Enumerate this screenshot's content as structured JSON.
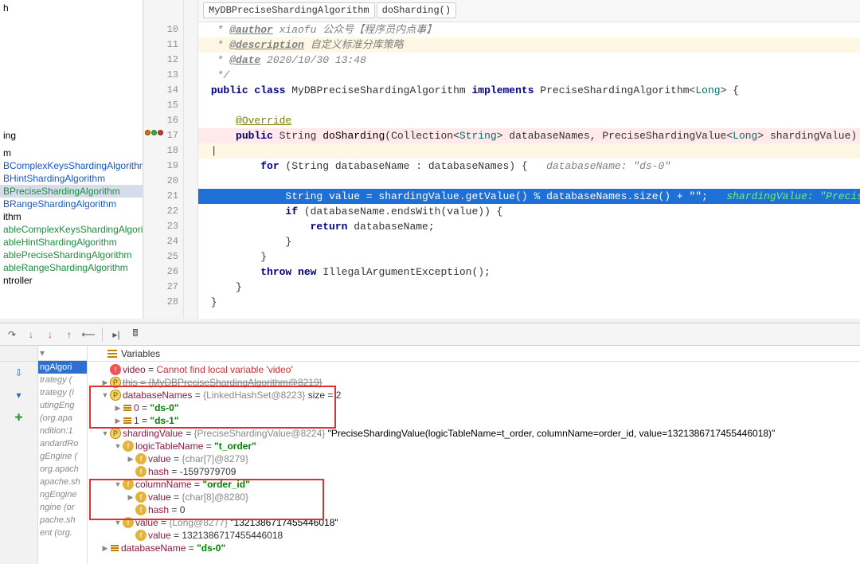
{
  "breadcrumb": {
    "class": "MyDBPreciseShardingAlgorithm",
    "method": "doSharding()"
  },
  "sidebar": {
    "topItems": [
      "h",
      "",
      "",
      "",
      "",
      "",
      "ing"
    ],
    "packages": [
      "m",
      "ithm"
    ],
    "classes": [
      {
        "label": "BComplexKeysShardingAlgorithm",
        "kind": "blue"
      },
      {
        "label": "BHintShardingAlgorithm",
        "kind": "blue"
      },
      {
        "label": "BPreciseShardingAlgorithm",
        "kind": "green",
        "selected": true
      },
      {
        "label": "BRangeShardingAlgorithm",
        "kind": "blue"
      },
      {
        "label": "ableComplexKeysShardingAlgorithm",
        "kind": "green"
      },
      {
        "label": "ableHintShardingAlgorithm",
        "kind": "green"
      },
      {
        "label": "ablePreciseShardingAlgorithm",
        "kind": "green"
      },
      {
        "label": "ableRangeShardingAlgorithm",
        "kind": "green"
      }
    ],
    "controllerLabel": "ntroller"
  },
  "code": {
    "startLine": 10,
    "lines": [
      {
        "n": 10,
        "html": "  <span class='jd'>* <span class='tag'>@author</span> xiaofu 公众号【程序员内点事】</span>"
      },
      {
        "n": 11,
        "html": "  <span class='jd'>* <span class='tag'>@description</span> 自定义标准分库策略</span>",
        "hly": true
      },
      {
        "n": 12,
        "html": "  <span class='jd'>* <span class='tag'>@date</span> 2020/10/30 13:48</span>"
      },
      {
        "n": 13,
        "html": "  <span class='jd'>*/</span>"
      },
      {
        "n": 14,
        "html": " <span class='kw'>public class</span> MyDBPreciseShardingAlgorithm <span class='kw'>implements</span> PreciseShardingAlgorithm&lt;<span class='generic'>Long</span>&gt; {"
      },
      {
        "n": 15,
        "html": " "
      },
      {
        "n": 16,
        "html": "     <span class='ann-u'>@Override</span>"
      },
      {
        "n": 17,
        "html": "     <span class='kw'>public</span> String <span class='methodname'>doSharding</span>(Collection&lt;<span class='generic'>String</span>&gt; databaseNames, PreciseShardingValue&lt;<span class='generic'>Long</span>&gt; shardingValue) {  <span class='inline-debug'></span>",
        "bp": true,
        "markers": true
      },
      {
        "n": 18,
        "html": " |",
        "hly": true
      },
      {
        "n": 19,
        "html": "         <span class='kw'>for</span> (String databaseName : databaseNames) {   <span class='inline-debug'>databaseName: \"ds-0\"</span>"
      },
      {
        "n": 20,
        "html": " "
      },
      {
        "n": 21,
        "html": "             String value = shardingValue.getValue() % databaseNames.size() + <span class='kw-inline'>\"\"</span>;   <span class='inlines'>shardingValue: \"PreciseSha</span>",
        "exec": true
      },
      {
        "n": 22,
        "html": "             <span class='kw'>if</span> (databaseName.endsWith(value)) {"
      },
      {
        "n": 23,
        "html": "                 <span class='kw'>return</span> databaseName;"
      },
      {
        "n": 24,
        "html": "             }"
      },
      {
        "n": 25,
        "html": "         }"
      },
      {
        "n": 26,
        "html": "         <span class='kw'>throw new</span> IllegalArgumentException();"
      },
      {
        "n": 27,
        "html": "     }"
      },
      {
        "n": 28,
        "html": " }"
      }
    ]
  },
  "debugger": {
    "variablesTab": "Variables",
    "frames": [
      {
        "label": "ngAlgori",
        "sel": true
      },
      {
        "label": "trategy ("
      },
      {
        "label": "trategy (i"
      },
      {
        "label": "utingEng"
      },
      {
        "label": "(org.apa"
      },
      {
        "label": "ndition:1"
      },
      {
        "label": "andardRo"
      },
      {
        "label": "gEngine ("
      },
      {
        "label": "org.apach"
      },
      {
        "label": "apache.sh"
      },
      {
        "label": "ngEngine"
      },
      {
        "label": "ngine (or"
      },
      {
        "label": "pache.sh"
      },
      {
        "label": "ent (org."
      }
    ],
    "vars": [
      {
        "depth": 0,
        "arrow": "",
        "icon": "e",
        "html": "<span class='k'>video</span> = <span class='err'>Cannot find local variable 'video'</span>"
      },
      {
        "depth": 0,
        "arrow": "▶",
        "icon": "p",
        "html": "<span class='strike'>this = {MyDBPreciseShardingAlgorithm@8219}</span>"
      },
      {
        "depth": 0,
        "arrow": "▼",
        "icon": "p",
        "html": "<span class='k'>databaseNames</span> <span class='eq'>=</span> <span class='cls'>{LinkedHashSet@8223}</span>  size = 2"
      },
      {
        "depth": 1,
        "arrow": "▶",
        "icon": "idx",
        "html": "<span class='k'>0</span> = <span class='strval'>\"ds-0\"</span>"
      },
      {
        "depth": 1,
        "arrow": "▶",
        "icon": "idx",
        "html": "<span class='k'>1</span> = <span class='strval'>\"ds-1\"</span>"
      },
      {
        "depth": 0,
        "arrow": "▼",
        "icon": "p",
        "html": "<span class='k'>shardingValue</span> <span class='eq'>=</span> <span class='cls'>{PreciseShardingValue@8224}</span> <span class='val'>\"PreciseShardingValue(logicTableName=t_order, columnName=order_id, value=1321386717455446018)\"</span>"
      },
      {
        "depth": 1,
        "arrow": "▼",
        "icon": "f",
        "html": "<span class='k'>logicTableName</span> = <span class='strval'>\"t_order\"</span>"
      },
      {
        "depth": 2,
        "arrow": "▶",
        "icon": "f",
        "html": "<span class='k'>value</span> = <span class='cls'>{char[7]@8279}</span>"
      },
      {
        "depth": 2,
        "arrow": "",
        "icon": "f",
        "html": "<span class='k'>hash</span> = -1597979709"
      },
      {
        "depth": 1,
        "arrow": "▼",
        "icon": "f",
        "html": "<span class='k'>columnName</span> = <span class='strval'>\"order_id\"</span>"
      },
      {
        "depth": 2,
        "arrow": "▶",
        "icon": "f",
        "html": "<span class='k'>value</span> = <span class='cls'>{char[8]@8280}</span>"
      },
      {
        "depth": 2,
        "arrow": "",
        "icon": "f",
        "html": "<span class='k'>hash</span> = 0"
      },
      {
        "depth": 1,
        "arrow": "▼",
        "icon": "f",
        "html": "<span class='k'>value</span> = <span class='cls'>{Long@8277}</span> <span class='val'>\"1321386717455446018\"</span>"
      },
      {
        "depth": 2,
        "arrow": "",
        "icon": "f",
        "html": "<span class='k'>value</span> = 1321386717455446018"
      },
      {
        "depth": 0,
        "arrow": "▶",
        "icon": "idx",
        "html": "<span class='k'>databaseName</span> = <span class='strval'>\"ds-0\"</span>"
      }
    ]
  }
}
